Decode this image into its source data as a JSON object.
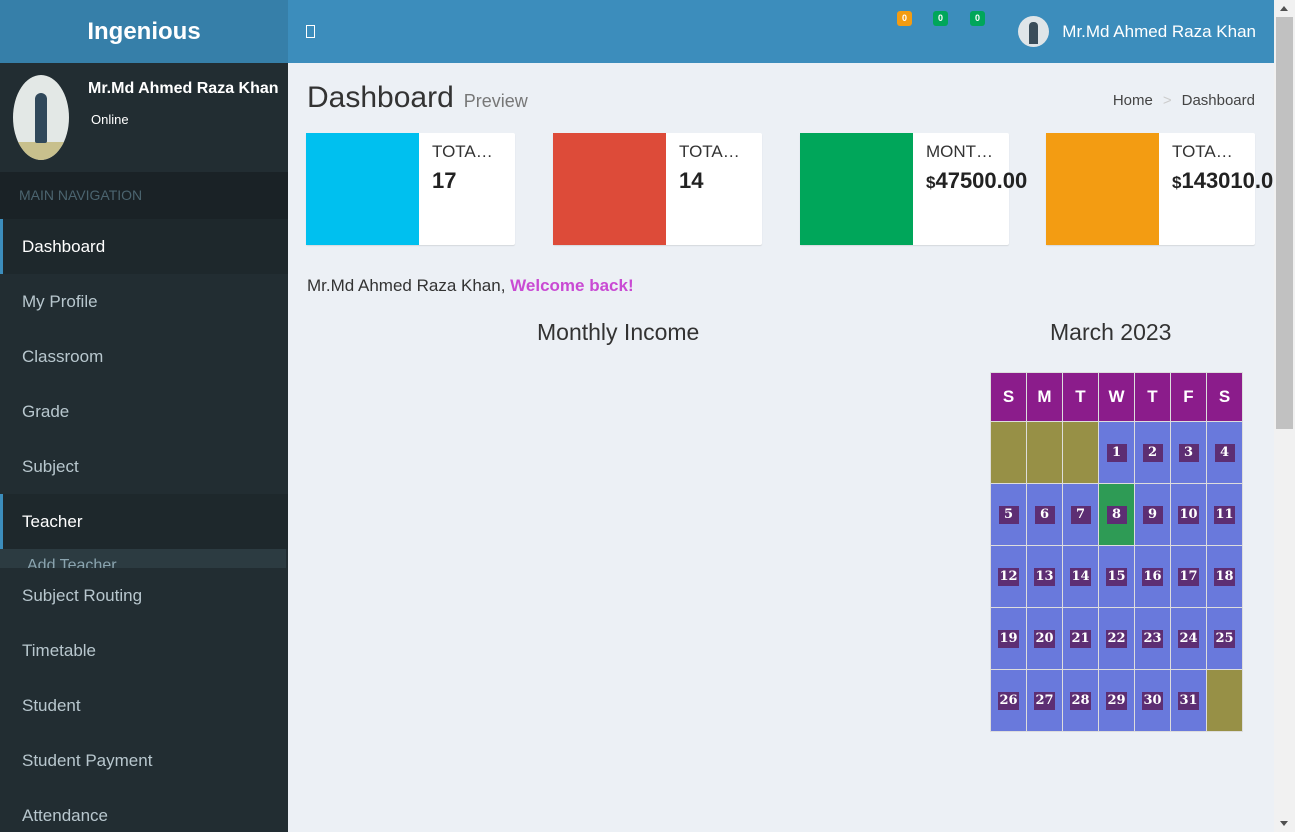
{
  "app": {
    "logo": "Ingenious"
  },
  "topbar": {
    "badges": [
      {
        "count": "0",
        "color": "#f39c12"
      },
      {
        "count": "0",
        "color": "#00a65a"
      },
      {
        "count": "0",
        "color": "#00a65a"
      }
    ],
    "user_name": "Mr.Md Ahmed Raza Khan"
  },
  "sidebar": {
    "user_name": "Mr.Md Ahmed Raza Khan",
    "status": "Online",
    "nav_header": "MAIN NAVIGATION",
    "items": [
      {
        "label": "Dashboard"
      },
      {
        "label": "My Profile"
      },
      {
        "label": "Classroom"
      },
      {
        "label": "Grade"
      },
      {
        "label": "Subject"
      },
      {
        "label": "Teacher"
      },
      {
        "label": "Add Teacher"
      },
      {
        "label": "Subject Routing"
      },
      {
        "label": "Timetable"
      },
      {
        "label": "Student"
      },
      {
        "label": "Student Payment"
      },
      {
        "label": "Attendance"
      }
    ]
  },
  "page": {
    "title": "Dashboard",
    "subtitle": "Preview",
    "breadcrumb": {
      "home": "Home",
      "sep": ">",
      "current": "Dashboard"
    }
  },
  "info_boxes": [
    {
      "label": "TOTA…",
      "value": "17",
      "currency": "",
      "color": "#00c0ef"
    },
    {
      "label": "TOTA…",
      "value": "14",
      "currency": "",
      "color": "#dd4b39"
    },
    {
      "label": "MONT…",
      "value": "47500.00",
      "currency": "$",
      "color": "#00a65a"
    },
    {
      "label": "TOTA…",
      "value": "143010.0",
      "currency": "$",
      "color": "#f39c12"
    }
  ],
  "welcome": {
    "name": "Mr.Md Ahmed Raza Khan,",
    "message": "Welcome back!"
  },
  "monthly_income": {
    "title": "Monthly Income"
  },
  "calendar": {
    "title": "March 2023",
    "weekdays": [
      "S",
      "M",
      "T",
      "W",
      "T",
      "F",
      "S"
    ],
    "weeks": [
      [
        "",
        "",
        "",
        "1",
        "2",
        "3",
        "4"
      ],
      [
        "5",
        "6",
        "7",
        "8",
        "9",
        "10",
        "11"
      ],
      [
        "12",
        "13",
        "14",
        "15",
        "16",
        "17",
        "18"
      ],
      [
        "19",
        "20",
        "21",
        "22",
        "23",
        "24",
        "25"
      ],
      [
        "26",
        "27",
        "28",
        "29",
        "30",
        "31",
        ""
      ]
    ],
    "today": "8"
  }
}
